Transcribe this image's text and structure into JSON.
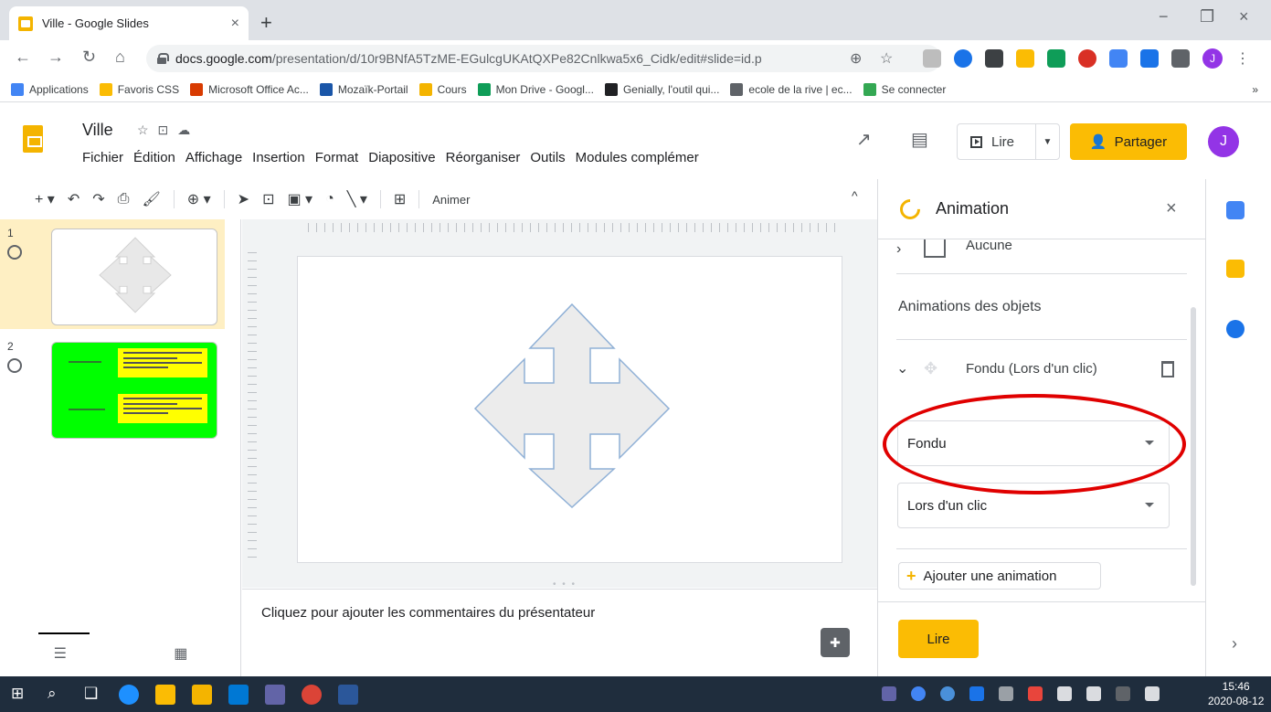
{
  "browser": {
    "tab_title": "Ville - Google Slides",
    "tab_close": "×",
    "new_tab": "+",
    "window_controls": [
      "−",
      "❐",
      "×"
    ],
    "url_host": "docs.google.com",
    "url_path": "/presentation/d/10r9BNfA5TzME-EGulcgUKAtQXPe82Cnlkwa5x6_Cidk/edit#slide=id.p",
    "profile_initial": "J",
    "bookmarks": [
      {
        "label": "Applications",
        "color": "#4285f4"
      },
      {
        "label": "Favoris CSS",
        "color": "#fbbc04"
      },
      {
        "label": "Microsoft Office Ac...",
        "color": "#d83b01"
      },
      {
        "label": "Mozaïk-Portail",
        "color": "#1a56a8"
      },
      {
        "label": "Cours",
        "color": "#f4b400"
      },
      {
        "label": "Mon Drive - Googl...",
        "color": "#0f9d58"
      },
      {
        "label": "Genially, l'outil qui...",
        "color": "#202124"
      },
      {
        "label": "ecole de la rive | ec...",
        "color": "#5f6368"
      },
      {
        "label": "Se connecter",
        "color": "#34a853"
      }
    ],
    "bookmarks_more": "»"
  },
  "slides": {
    "doc_title": "Ville",
    "menu": [
      "Fichier",
      "Édition",
      "Affichage",
      "Insertion",
      "Format",
      "Diapositive",
      "Réorganiser",
      "Outils",
      "Modules complémer"
    ],
    "present_label": "Lire",
    "share_label": "Partager",
    "account_initial": "J",
    "toolbar_animate": "Animer",
    "notes_placeholder": "Cliquez pour ajouter les commentaires du présentateur",
    "filmstrip": [
      {
        "number": "1"
      },
      {
        "number": "2"
      }
    ]
  },
  "animation_panel": {
    "title": "Animation",
    "close": "×",
    "slide_transition": "Aucune",
    "objects_section": "Animations des objets",
    "item_label": "Fondu  (Lors d'un clic)",
    "effect_value": "Fondu",
    "trigger_value": "Lors d'un clic",
    "add_button": "Ajouter une animation",
    "play_button": "Lire"
  },
  "taskbar": {
    "time": "15:46",
    "date": "2020-08-12"
  },
  "colors": {
    "accent_yellow": "#fbbc04",
    "highlight_red": "#e00000",
    "thumb_green": "#00ff00"
  }
}
